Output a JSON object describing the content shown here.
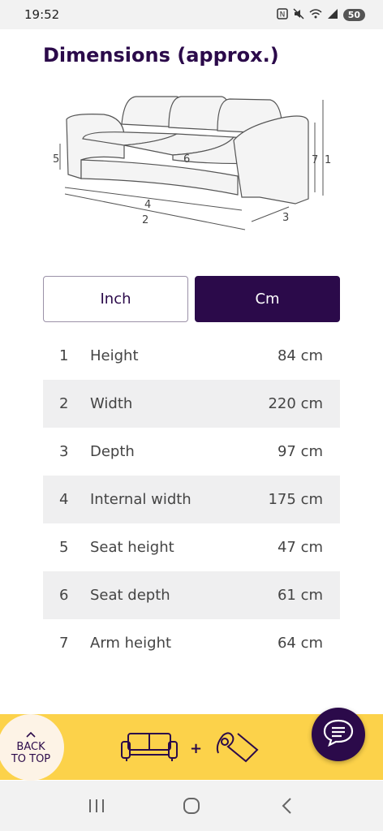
{
  "status_bar": {
    "time": "19:52",
    "icons": [
      "nfc-icon",
      "mute-icon",
      "wifi-icon",
      "signal-icon"
    ],
    "battery": "50"
  },
  "page": {
    "title": "Dimensions (approx.)"
  },
  "diagram": {
    "labels": {
      "a": "1",
      "b": "2",
      "c": "3",
      "d": "4",
      "e": "5",
      "f": "6",
      "g": "7"
    }
  },
  "unit_toggle": {
    "inch_label": "Inch",
    "cm_label": "Cm",
    "selected": "Cm"
  },
  "dimensions": [
    {
      "num": "1",
      "label": "Height",
      "value": "84 cm"
    },
    {
      "num": "2",
      "label": "Width",
      "value": "220 cm"
    },
    {
      "num": "3",
      "label": "Depth",
      "value": "97 cm"
    },
    {
      "num": "4",
      "label": "Internal width",
      "value": "175 cm"
    },
    {
      "num": "5",
      "label": "Seat height",
      "value": "47 cm"
    },
    {
      "num": "6",
      "label": "Seat depth",
      "value": "61 cm"
    },
    {
      "num": "7",
      "label": "Arm height",
      "value": "64 cm"
    }
  ],
  "bottom_bar": {
    "back_to_top_line1": "BACK",
    "back_to_top_line2": "TO TOP",
    "plus": "+"
  },
  "colors": {
    "brand_purple": "#2b0a4a",
    "banner_yellow": "#fcd24a",
    "row_alt": "#efeff0"
  }
}
